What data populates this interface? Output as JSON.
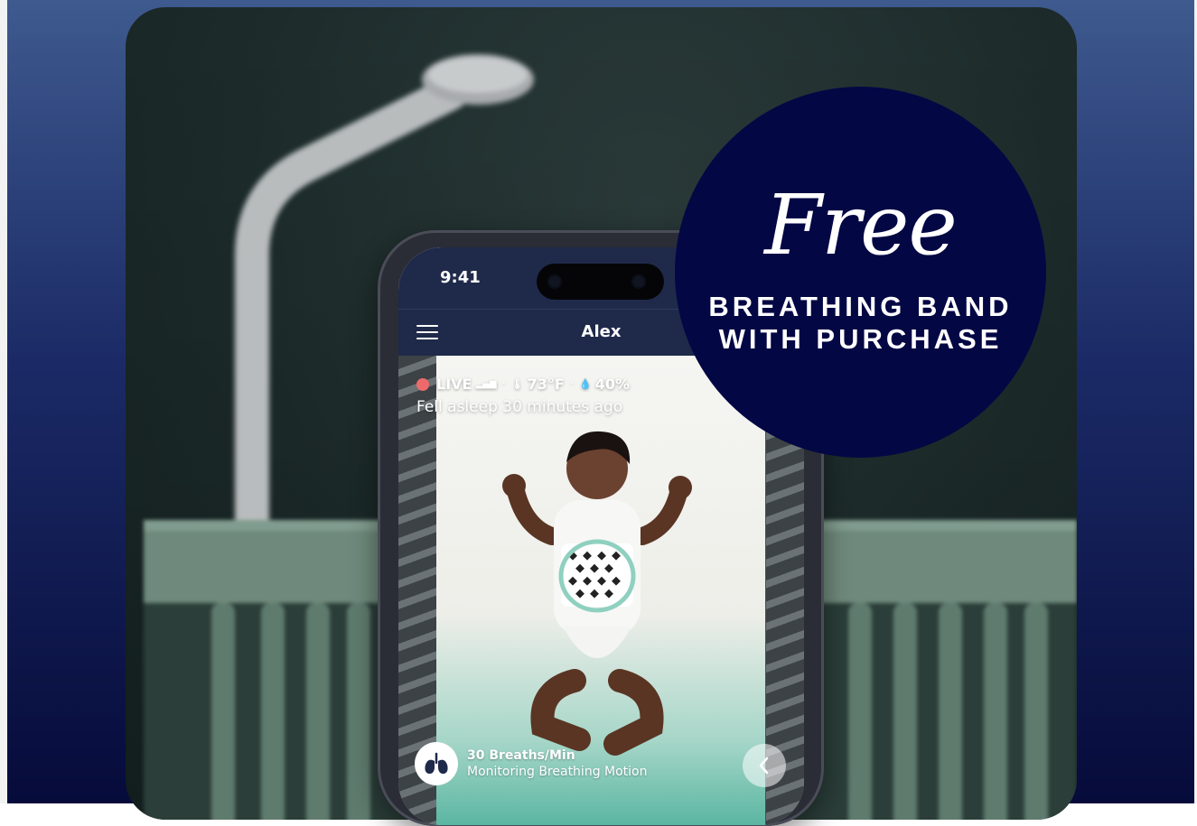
{
  "phone": {
    "status_time": "9:41",
    "app_title": "Alex",
    "live_label": "LIVE",
    "temperature": "73°F",
    "humidity": "40%",
    "sleep_status": "Fell asleep 30 minutes ago",
    "breath_rate": "30 Breaths/Min",
    "breath_status": "Monitoring Breathing Motion"
  },
  "promo": {
    "headline": "Free",
    "line1": "BREATHING BAND",
    "line2": "WITH PURCHASE"
  },
  "colors": {
    "background": "#1b2a66",
    "badge": "#030744",
    "app_bar": "#1f2a4a",
    "live_dot": "#ee6a6a",
    "breathing_band": "#8fd0c0"
  },
  "icons": {
    "menu": "hamburger-icon",
    "signal": "signal-icon",
    "temperature": "thermometer-icon",
    "humidity": "droplet-icon",
    "lungs": "lungs-icon",
    "back": "chevron-left-icon"
  }
}
